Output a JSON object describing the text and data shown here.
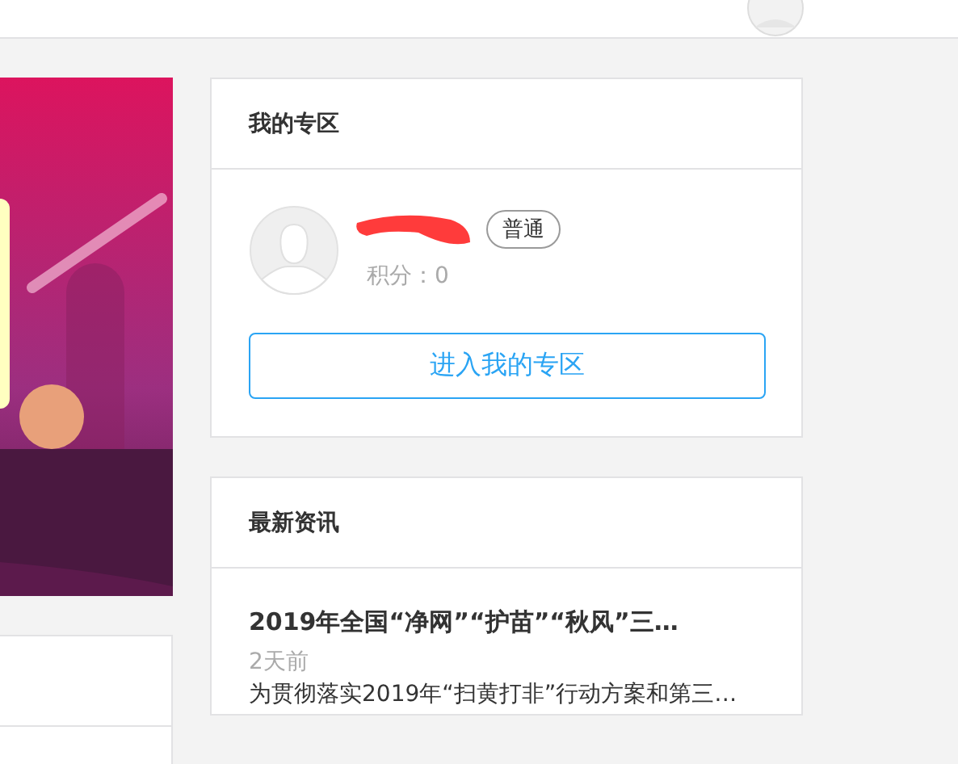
{
  "zone_card": {
    "title": "我的专区",
    "user": {
      "badge": "普通",
      "points": "积分：0"
    },
    "enter_button": "进入我的专区"
  },
  "news_card": {
    "title": "最新资讯",
    "items": [
      {
        "title": "2019年全国“净网”“护苗”“秋风”三…",
        "time": "2天前",
        "summary": "为贯彻落实2019年“扫黄打非”行动方案和第三…"
      }
    ]
  }
}
